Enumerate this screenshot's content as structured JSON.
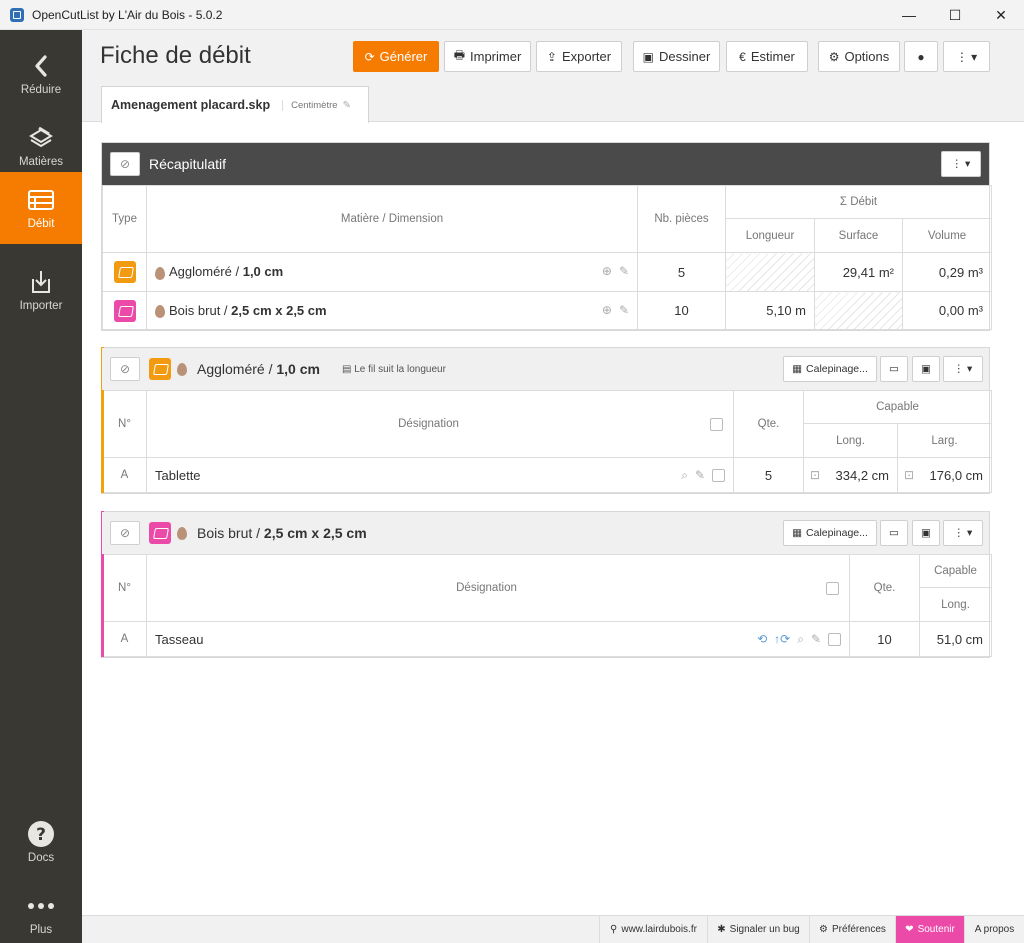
{
  "window": {
    "title": "OpenCutList by L'Air du Bois - 5.0.2",
    "minimize": "—",
    "maximize": "☐",
    "close": "✕"
  },
  "sidebar": {
    "items": [
      {
        "label": "Réduire",
        "icon": "chevron-left-icon"
      },
      {
        "label": "Matières",
        "icon": "materials-icon"
      },
      {
        "label": "Débit",
        "icon": "cutlist-icon"
      },
      {
        "label": "Importer",
        "icon": "import-icon"
      },
      {
        "label": "Docs",
        "icon": "help-icon"
      },
      {
        "label": "Plus",
        "icon": "more-icon"
      }
    ]
  },
  "header": {
    "title": "Fiche de débit",
    "buttons": {
      "generate": "Générer",
      "print": "Imprimer",
      "export": "Exporter",
      "draw": "Dessiner",
      "estimate": "Estimer",
      "options": "Options"
    },
    "tab": {
      "filename": "Amenagement placard.skp",
      "unit": "Centimètre"
    }
  },
  "summary": {
    "title": "Récapitulatif",
    "headers": {
      "type": "Type",
      "material": "Matière / Dimension",
      "count": "Nb. pièces",
      "debit": "Σ Débit",
      "length": "Longueur",
      "surface": "Surface",
      "volume": "Volume"
    },
    "rows": [
      {
        "material": "Aggloméré",
        "dimension": "1,0 cm",
        "count": "5",
        "length": "",
        "surface": "29,41 m²",
        "volume": "0,29 m³"
      },
      {
        "material": "Bois brut",
        "dimension": "2,5 cm x 2,5 cm",
        "count": "10",
        "length": "5,10 m",
        "surface": "",
        "volume": "0,00 m³"
      }
    ]
  },
  "group1": {
    "material": "Aggloméré",
    "dimension": "1,0 cm",
    "grain_note": "Le fil suit la longueur",
    "layout_button": "Calepinage...",
    "headers": {
      "num": "N°",
      "designation": "Désignation",
      "qty": "Qte.",
      "capable": "Capable",
      "long": "Long.",
      "larg": "Larg."
    },
    "rows": [
      {
        "num": "A",
        "designation": "Tablette",
        "qty": "5",
        "long": "334,2 cm",
        "larg": "176,0 cm"
      }
    ]
  },
  "group2": {
    "material": "Bois brut",
    "dimension": "2,5 cm x 2,5 cm",
    "layout_button": "Calepinage...",
    "headers": {
      "num": "N°",
      "designation": "Désignation",
      "qty": "Qte.",
      "capable": "Capable",
      "long": "Long."
    },
    "rows": [
      {
        "num": "A",
        "designation": "Tasseau",
        "qty": "10",
        "long": "51,0 cm"
      }
    ]
  },
  "footer": {
    "website": "www.lairdubois.fr",
    "bug": "Signaler un bug",
    "prefs": "Préférences",
    "support": "Soutenir",
    "about": "A propos"
  },
  "colors": {
    "accent": "#f57c00",
    "sidebar": "#3a3832",
    "orange_material": "#f29a10",
    "pink_material": "#ec4aa8"
  }
}
